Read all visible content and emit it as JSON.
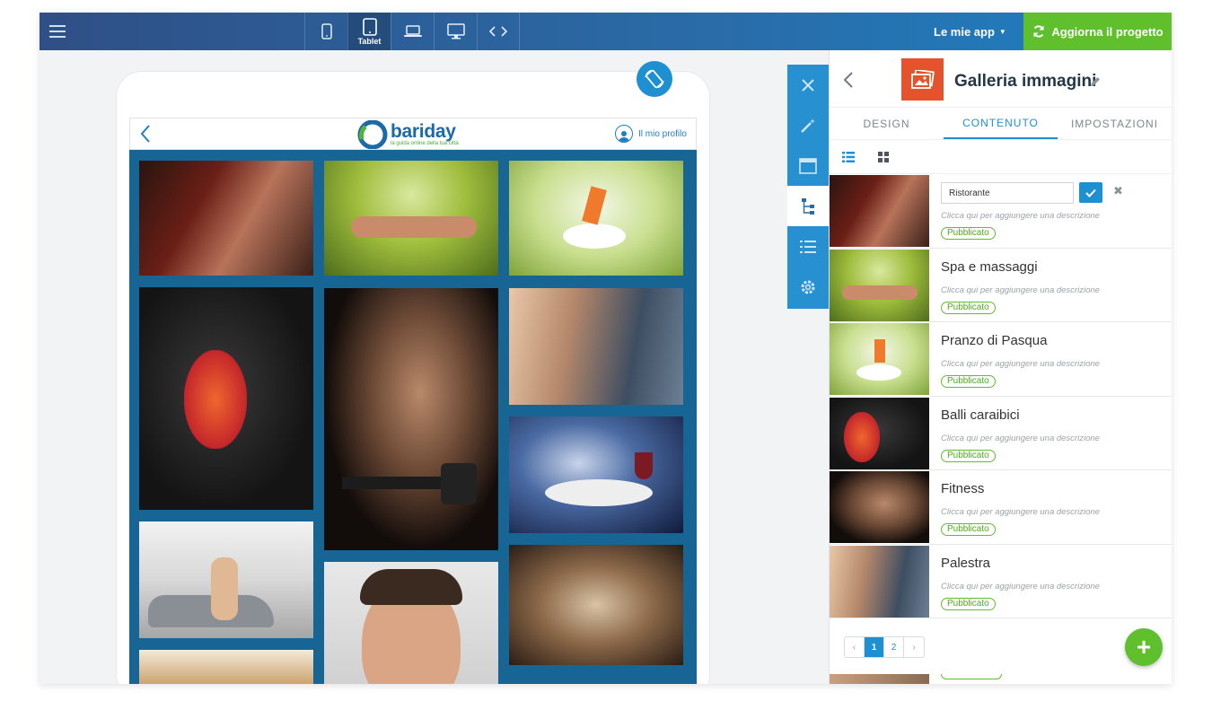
{
  "topbar": {
    "devices": [
      {
        "name": "phone",
        "label": ""
      },
      {
        "name": "tablet",
        "label": "Tablet"
      },
      {
        "name": "laptop",
        "label": ""
      },
      {
        "name": "desktop",
        "label": ""
      },
      {
        "name": "code",
        "label": ""
      }
    ],
    "active_device": "tablet",
    "my_apps_label": "Le mie app",
    "update_label": "Aggiorna il progetto"
  },
  "preview": {
    "logo_word": "bariday",
    "logo_tagline": "la guida online della tua città",
    "profile_label": "Il mio profilo"
  },
  "tools": [
    "close-icon",
    "magic-wand-icon",
    "layout-icon",
    "tree-icon",
    "list-icon",
    "gear-icon"
  ],
  "panel": {
    "title": "Galleria immagini",
    "tabs": [
      "DESIGN",
      "CONTENUTO",
      "IMPOSTAZIONI"
    ],
    "active_tab": "CONTENUTO",
    "editing_value": "Ristorante",
    "description_placeholder": "Clicca qui per aggiungere una descrizione",
    "status_label": "Pubblicato",
    "items": [
      {
        "title": "Ristorante",
        "status": "Pubblicato"
      },
      {
        "title": "Spa e massaggi",
        "status": "Pubblicato"
      },
      {
        "title": "Pranzo di Pasqua",
        "status": "Pubblicato"
      },
      {
        "title": "Balli caraibici",
        "status": "Pubblicato"
      },
      {
        "title": "Fitness",
        "status": "Pubblicato"
      },
      {
        "title": "Palestra",
        "status": "Pubblicato"
      }
    ],
    "pagination": {
      "prev": "‹",
      "pages": [
        "1",
        "2"
      ],
      "current": "1",
      "next": "›"
    },
    "add_label": "+"
  },
  "colors": {
    "accent": "#1e8fd0",
    "success": "#5fbf2c",
    "brand": "#2f4f86",
    "gallery_bg": "#176595",
    "panel_icon": "#e4532c"
  }
}
